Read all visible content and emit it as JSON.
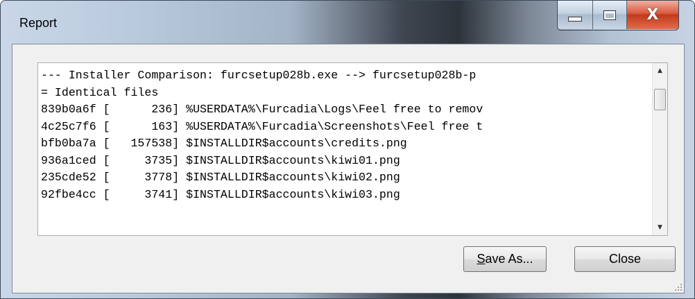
{
  "window": {
    "title": "Report",
    "caption_buttons": {
      "minimize_icon": "minimize-icon",
      "maximize_icon": "maximize-icon",
      "close_glyph": "X"
    }
  },
  "report": {
    "lines": [
      "--- Installer Comparison: furcsetup028b.exe --> furcsetup028b-p",
      "= Identical files",
      "839b0a6f [      236] %USERDATA%\\Furcadia\\Logs\\Feel free to remov",
      "4c25c7f6 [      163] %USERDATA%\\Furcadia\\Screenshots\\Feel free t",
      "bfb0ba7a [   157538] $INSTALLDIR$accounts\\credits.png",
      "936a1ced [     3735] $INSTALLDIR$accounts\\kiwi01.png",
      "235cde52 [     3778] $INSTALLDIR$accounts\\kiwi02.png",
      "92fbe4cc [     3741] $INSTALLDIR$accounts\\kiwi03.png"
    ],
    "scroll": {
      "up_arrow": "▲",
      "down_arrow": "▼"
    }
  },
  "buttons": {
    "save_as_accel": "S",
    "save_as_rest": "ave As...",
    "close": "Close"
  }
}
